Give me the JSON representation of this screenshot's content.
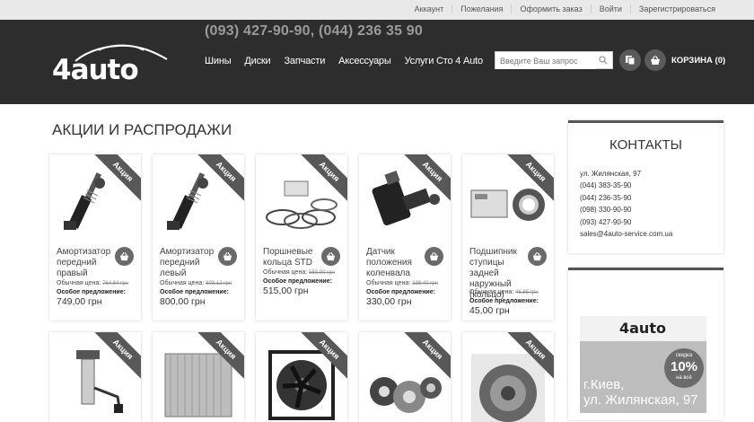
{
  "top_links": [
    "Аккаунт",
    "Пожелания",
    "Оформить заказ",
    "Войти",
    "Зарегистрироваться"
  ],
  "header": {
    "logo_text": "4auto",
    "phones": "(093) 427-90-90, (044) 236 35 90",
    "nav": [
      "Шины",
      "Диски",
      "Запчасти",
      "Аксессуары",
      "Услуги Сто 4 Auto"
    ],
    "search_placeholder": "Введите Ваш запрос",
    "cart_label": "КОРЗИНА (0)"
  },
  "page_title": "АКЦИИ И РАСПРОДАЖИ",
  "ribbon_label": "Акция",
  "products": [
    {
      "name": "Амортизатор передний правый",
      "old_label": "Обычная цена:",
      "old_price": "764,64 грн",
      "special_label": "Особое предложение:",
      "price": "749,00 грн",
      "icon": "shock-absorber"
    },
    {
      "name": "Амортизатор передний левый",
      "old_label": "Обычная цена:",
      "old_price": "803,12 грн",
      "special_label": "Особое предложение:",
      "price": "800,00 грн",
      "icon": "shock-absorber"
    },
    {
      "name": "Поршневые кольца STD",
      "old_label": "Обычная цена:",
      "old_price": "558,00 грн",
      "special_label": "Особое предложение:",
      "price": "515,00 грн",
      "icon": "piston-rings"
    },
    {
      "name": "Датчик положения коленвала",
      "old_label": "Обычная цена:",
      "old_price": "338,40 грн",
      "special_label": "Особое предложение:",
      "price": "330,00 грн",
      "icon": "sensor"
    },
    {
      "name": "Подшипник ступицы задней наружный (кольцо)",
      "old_label": "Обычная цена:",
      "old_price": "46,65 грн",
      "special_label": "Особое предложение:",
      "price": "45,00 грн",
      "icon": "bearing"
    },
    {
      "name": "",
      "icon": "fuel-pump"
    },
    {
      "name": "",
      "icon": "radiator"
    },
    {
      "name": "",
      "icon": "fan"
    },
    {
      "name": "",
      "icon": "clutch-kit"
    },
    {
      "name": "",
      "icon": "clutch-disc"
    }
  ],
  "sidebar": {
    "contacts_title": "КОНТАКТЫ",
    "address": "ул. Жилянская, 97",
    "phones": [
      "(044) 383-35-90",
      "(044) 236-35-90",
      "(098) 330-90-90",
      "(093) 427-90-90"
    ],
    "email": "sales@4auto-service.com.ua",
    "banner": {
      "logo": "4auto",
      "badge_top": "скидка",
      "badge_value": "10%",
      "badge_bottom": "на всё",
      "city_line1": "г.Киев,",
      "city_line2": "ул. Жилянская, 97"
    }
  },
  "colors": {
    "header_bg": "#2d2d2d",
    "topbar_bg": "#e9e9e9",
    "accent": "#585858"
  }
}
